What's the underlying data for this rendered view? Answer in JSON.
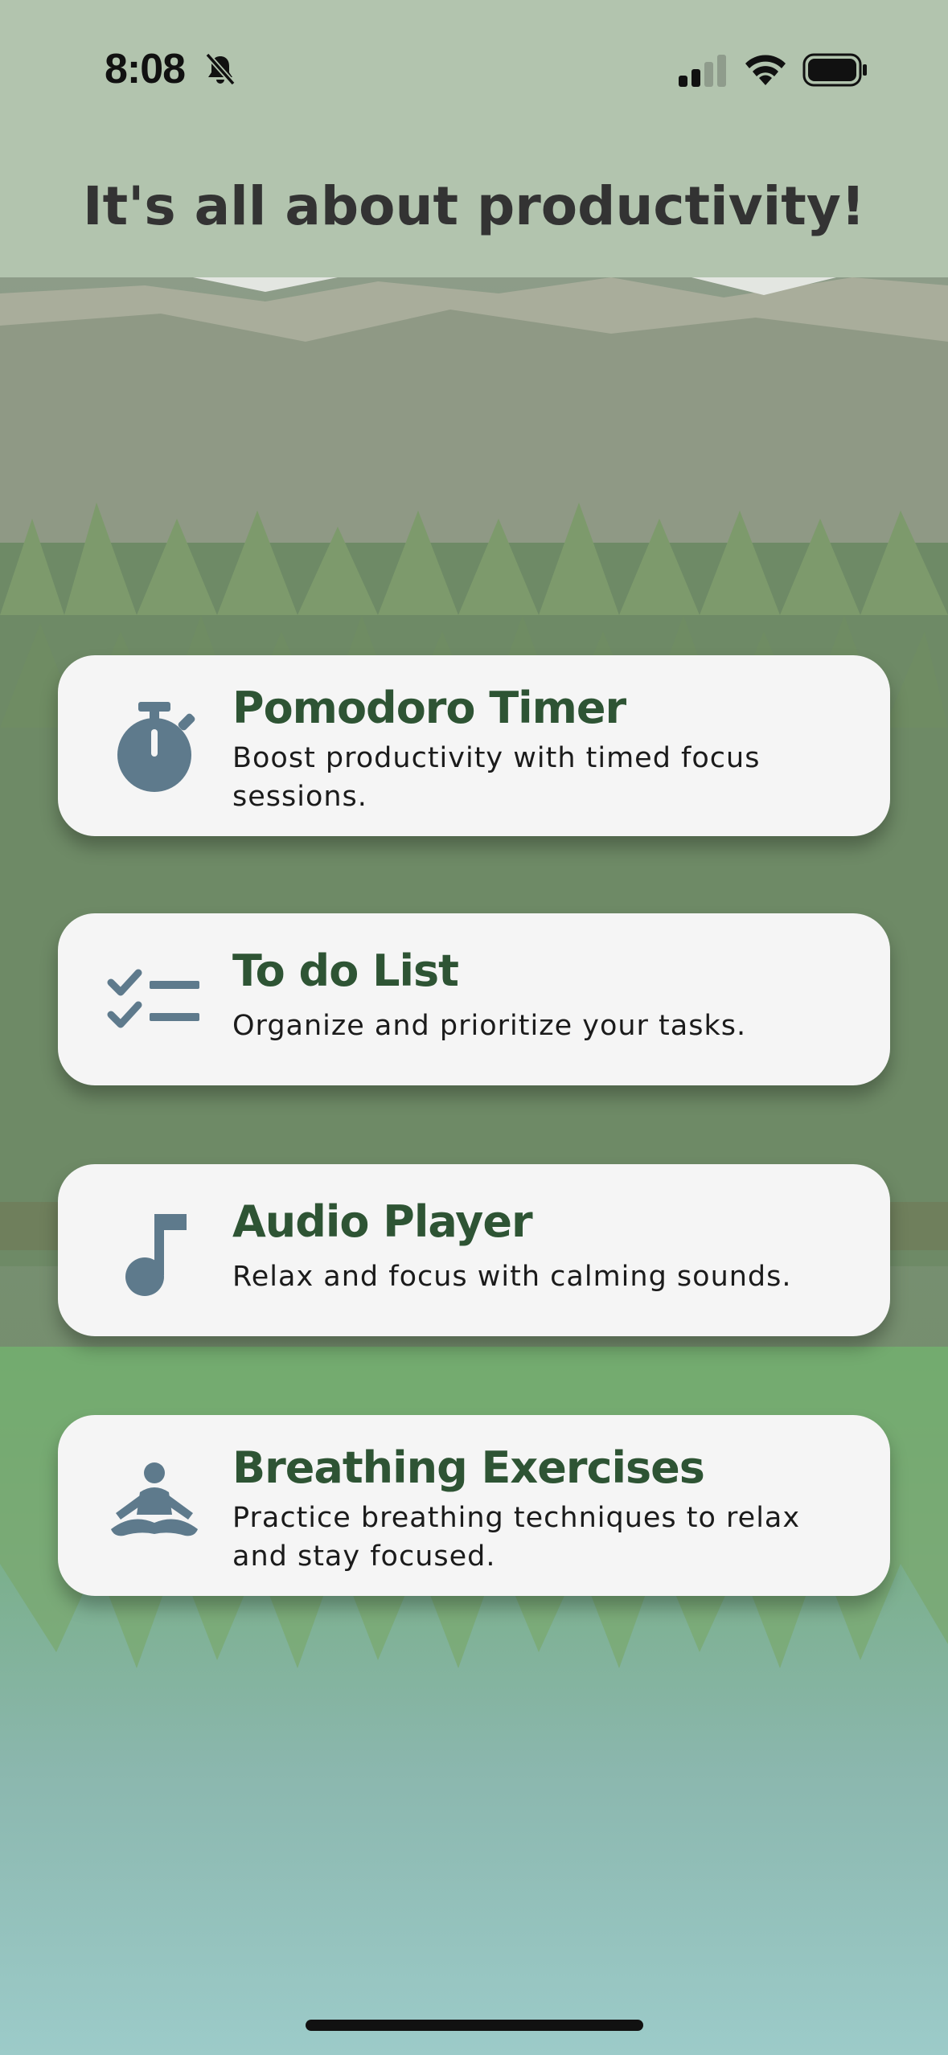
{
  "status_bar": {
    "time": "8:08",
    "icons": [
      "bell-slash-icon",
      "cellular-signal-icon",
      "wifi-icon",
      "battery-icon"
    ]
  },
  "header": {
    "title": "It's all about productivity!"
  },
  "features": [
    {
      "icon": "stopwatch-icon",
      "title": "Pomodoro Timer",
      "description": "Boost productivity with timed focus sessions."
    },
    {
      "icon": "checklist-icon",
      "title": "To do List",
      "description": "Organize and prioritize your tasks."
    },
    {
      "icon": "music-note-icon",
      "title": "Audio Player",
      "description": "Relax and focus with calming sounds."
    },
    {
      "icon": "meditation-icon",
      "title": "Breathing Exercises",
      "description": "Practice breathing techniques to relax and stay focused."
    }
  ],
  "colors": {
    "header_bg": "#b2c4ae",
    "card_bg": "#f5f5f5",
    "card_title": "#2e5434",
    "icon": "#5e7a8c"
  }
}
